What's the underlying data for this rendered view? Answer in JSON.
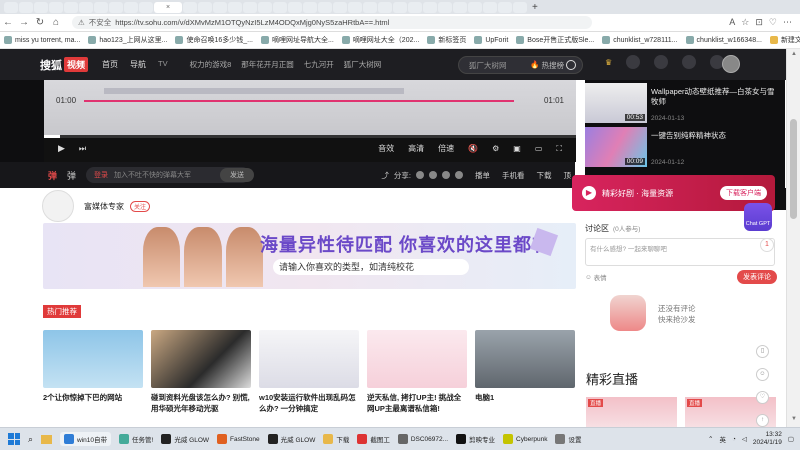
{
  "browser": {
    "insecure_label": "不安全",
    "url": "https://tv.sohu.com/v/dXMvMzM1OTQyNzI5LzM4ODQxMjg0NyS5zaHRtbA==.html",
    "back_glyph": "←",
    "forward_glyph": "→",
    "reload_glyph": "↻",
    "home_glyph": "⌂",
    "right_icons": [
      "A",
      "☆",
      "⊡",
      "♡",
      "⋯"
    ],
    "tab_plus": "+",
    "tab_close": "×"
  },
  "bookmarks": [
    "miss yu torrent, ma...",
    "hao123_上网从这里...",
    "使命召唤16多少钱_...",
    "嘀哩网址导航大全...",
    "嘀哩网址大全（202...",
    "新标签页",
    "UpForit",
    "Bose开售正式版Sle...",
    "chunklist_w728111...",
    "chunklist_w166348...",
    "新建文件夹",
    "其他收藏夹"
  ],
  "site": {
    "logo_text": "搜狐",
    "logo_video": "视频",
    "nav": [
      "首页",
      "导航"
    ],
    "nav_sub": "TV",
    "nav2": [
      "权力的游戏8",
      "那年花开月正圆",
      "七九河开",
      "狐厂大树网"
    ],
    "search_placeholder": "狐厂大树网",
    "hot_label": "热搜榜",
    "user_label": "登录"
  },
  "player": {
    "time_current": "01:00",
    "time_total": "01:01",
    "controls": [
      "音效",
      "高清",
      "倍速"
    ],
    "progress": 0.03,
    "barrage_label_a": "弹",
    "barrage_label_b": "弹",
    "barrage_login": "登录",
    "barrage_placeholder": "加入不吐不快的弹幕大军",
    "barrage_send": "发送",
    "share_label": "分享:",
    "actions": [
      "播单",
      "手机看",
      "下载",
      "顶"
    ]
  },
  "side_videos": [
    {
      "title": "Wallpaper动态壁纸推荐—白茶女与雪牧师",
      "date": "2024-01-13",
      "duration": "00:53"
    },
    {
      "title": "一键告别纯粹精神状态",
      "date": "2024-01-12",
      "duration": "00:09"
    }
  ],
  "author": {
    "name": "富媒体专家",
    "badge": "关注"
  },
  "promo": {
    "icon": "▶",
    "text": "精彩好剧 · 海量资源",
    "button": "下载客户端"
  },
  "banner": {
    "headline": "海量异性待匹配 你喜欢的这里都有",
    "subline": "请输入你喜欢的类型，如清纯校花"
  },
  "comments": {
    "header": "讨论区",
    "count": "(0人参与)",
    "placeholder": "有什么感想? 一起来聊聊吧",
    "expression": "表情",
    "post": "发表评论",
    "empty_line1": "还没有评论",
    "empty_line2": "快来抢沙发"
  },
  "hot": {
    "label": "热门推荐",
    "cards": [
      {
        "caption": "2个让你惊掉下巴的网站"
      },
      {
        "caption": "碰到资料光盘该怎么办? 别慌, 用华硕光年移动光驱"
      },
      {
        "caption": "w10安装运行软件出现乱码怎么办? 一分钟搞定"
      },
      {
        "caption": "逆天私信, 拷打UP主! 挑战全网UP主最离谱私信箱!"
      },
      {
        "caption": "电脑1"
      }
    ]
  },
  "live": {
    "title": "精彩直播",
    "tag": "直播"
  },
  "floating": {
    "chatgpt": "Chat GPT",
    "badge": "1"
  },
  "taskbar": {
    "items": [
      "win10自带",
      "任务管!",
      "光威 GLOW",
      "FastStone",
      "光威 GLOW",
      "下载",
      "截图工",
      "DSC06972...",
      "剪映专业",
      "Cyberpunk",
      "设置"
    ],
    "active_index": 0,
    "lang": "英",
    "time": "13:32",
    "date": "2024/1/19"
  },
  "colors": {
    "accent": "#e34a4a",
    "player_bg": "#0e0e10",
    "promo": "#d8245e",
    "banner_text": "#6b49c8"
  }
}
